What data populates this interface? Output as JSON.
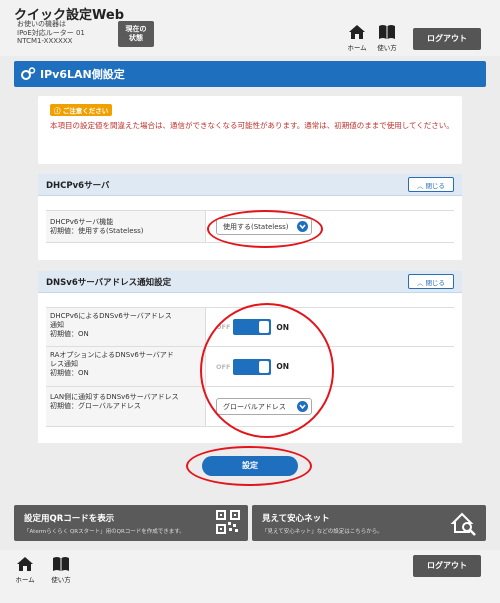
{
  "header": {
    "app_title": "クイック設定Web",
    "device_line1": "お使いの機器は",
    "device_line2": "IPoE対応ルーター 01",
    "device_line3": "NTCM1-XXXXXX",
    "status_label_1": "現在の",
    "status_label_2": "状態",
    "home_label": "ホーム",
    "help_label": "使い方",
    "logout_label": "ログアウト"
  },
  "section": {
    "title": "IPv6LAN側設定"
  },
  "notice": {
    "badge": "ご注意ください",
    "text": "本項目の設定値を間違えた場合は、通信ができなくなる可能性があります。通常は、初期値のままで使用してください。"
  },
  "dhcp_panel": {
    "title": "DHCPv6サーバ",
    "close_label": "閉じる",
    "row_label_1": "DHCPv6サーバ機能",
    "row_label_2": "初期値：使用する(Stateless)",
    "select_value": "使用する(Stateless)"
  },
  "dns_panel": {
    "title": "DNSv6サーバアドレス通知設定",
    "close_label": "閉じる",
    "rows": [
      {
        "label_1": "DHCPv6によるDNSv6サーバアドレス",
        "label_2": "通知",
        "label_3": "初期値：ON",
        "off": "OFF",
        "on": "ON",
        "enabled": true
      },
      {
        "label_1": "RAオプションによるDNSv6サーバアド",
        "label_2": "レス通知",
        "label_3": "初期値：ON",
        "off": "OFF",
        "on": "ON",
        "enabled": true
      },
      {
        "label_1": "LAN側に通知するDNSv6サーバアドレス",
        "label_2": "初期値：グローバルアドレス",
        "select_value": "グローバルアドレス"
      }
    ]
  },
  "apply_label": "設定",
  "banners": {
    "qr_title": "設定用QRコードを表示",
    "qr_sub": "「Atermらくらく QRスタート」用のQRコードを作成できます。",
    "safe_title": "見えて安心ネット",
    "safe_sub": "「見えて安心ネット」などの設定はこちらから。"
  },
  "footer": {
    "home_label": "ホーム",
    "help_label": "使い方",
    "logout_label": "ログアウト"
  },
  "colors": {
    "accent": "#1f6fbf",
    "highlight": "#e4151a",
    "warning": "#f0a000"
  }
}
